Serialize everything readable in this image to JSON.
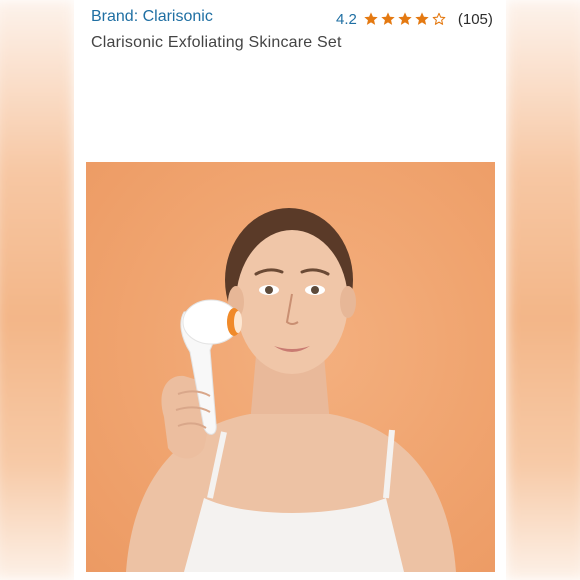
{
  "product": {
    "brand_link": "Brand: Clarisonic",
    "title": "Clarisonic Exfoliating Skincare Set"
  },
  "rating": {
    "value": "4.2",
    "count": "(105)",
    "stars_filled": 4,
    "stars_total": 5,
    "star_color": "#e47911",
    "link_color": "#1f6fa3"
  },
  "image": {
    "background_color": "#f0a46f"
  }
}
